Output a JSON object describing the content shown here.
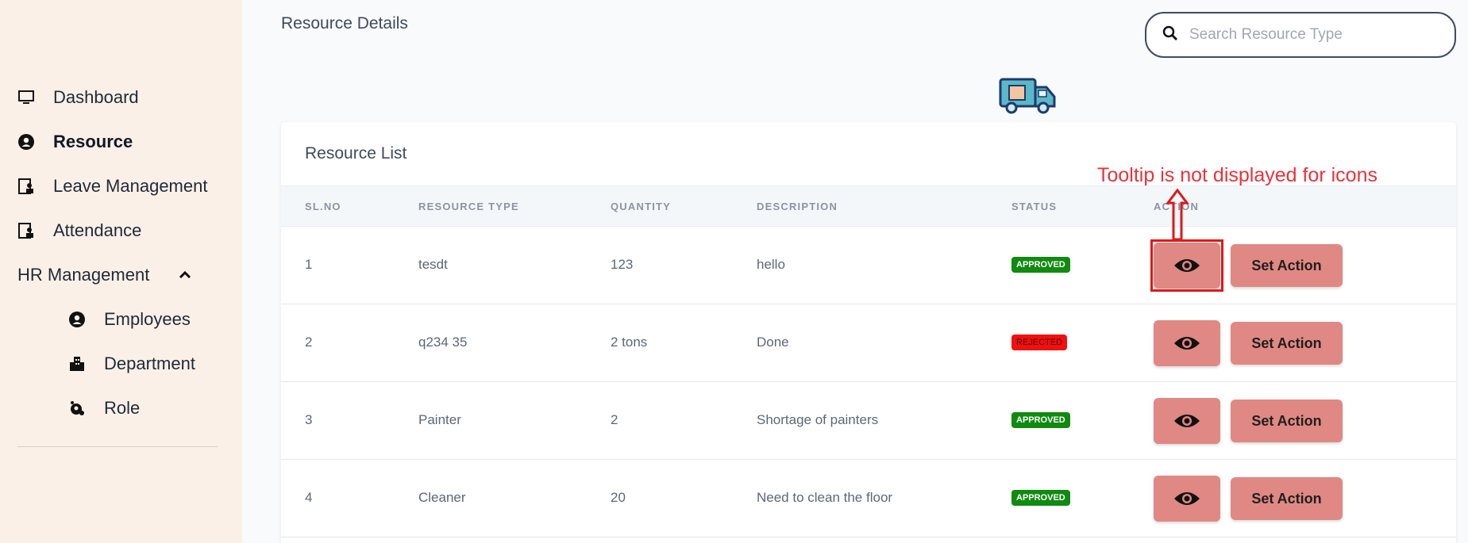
{
  "sidebar": {
    "items": [
      {
        "label": "Dashboard",
        "icon": "monitor-icon"
      },
      {
        "label": "Resource",
        "icon": "user-circle-icon",
        "active": true
      },
      {
        "label": "Leave Management",
        "icon": "id-card-icon"
      },
      {
        "label": "Attendance",
        "icon": "id-card-icon"
      },
      {
        "label": "HR Management",
        "icon": "chevron-up-icon"
      },
      {
        "label": "Employees",
        "icon": "user-circle-icon"
      },
      {
        "label": "Department",
        "icon": "building-icon"
      },
      {
        "label": "Role",
        "icon": "role-icon"
      }
    ]
  },
  "header": {
    "title": "Resource Details",
    "search_placeholder": "Search Resource Type"
  },
  "table": {
    "title": "Resource List",
    "columns": [
      "SL.NO",
      "RESOURCE TYPE",
      "QUANTITY",
      "DESCRIPTION",
      "STATUS",
      "ACTION"
    ],
    "rows": [
      {
        "slno": "1",
        "type": "tesdt",
        "quantity": "123",
        "description": "hello",
        "status": "APPROVED"
      },
      {
        "slno": "2",
        "type": "q234 35",
        "quantity": "2 tons",
        "description": "Done",
        "status": "REJECTED"
      },
      {
        "slno": "3",
        "type": "Painter",
        "quantity": "2",
        "description": "Shortage of painters",
        "status": "APPROVED"
      },
      {
        "slno": "4",
        "type": "Cleaner",
        "quantity": "20",
        "description": "Need to clean the floor",
        "status": "APPROVED"
      }
    ],
    "action_label": "Set Action"
  },
  "annotation": {
    "text": "Tooltip is not displayed for icons"
  },
  "colors": {
    "sidebar_bg": "#fbf0e8",
    "button": "#e08883",
    "approved": "#108a10",
    "rejected": "#ef1010",
    "annotation": "#e8333c"
  }
}
